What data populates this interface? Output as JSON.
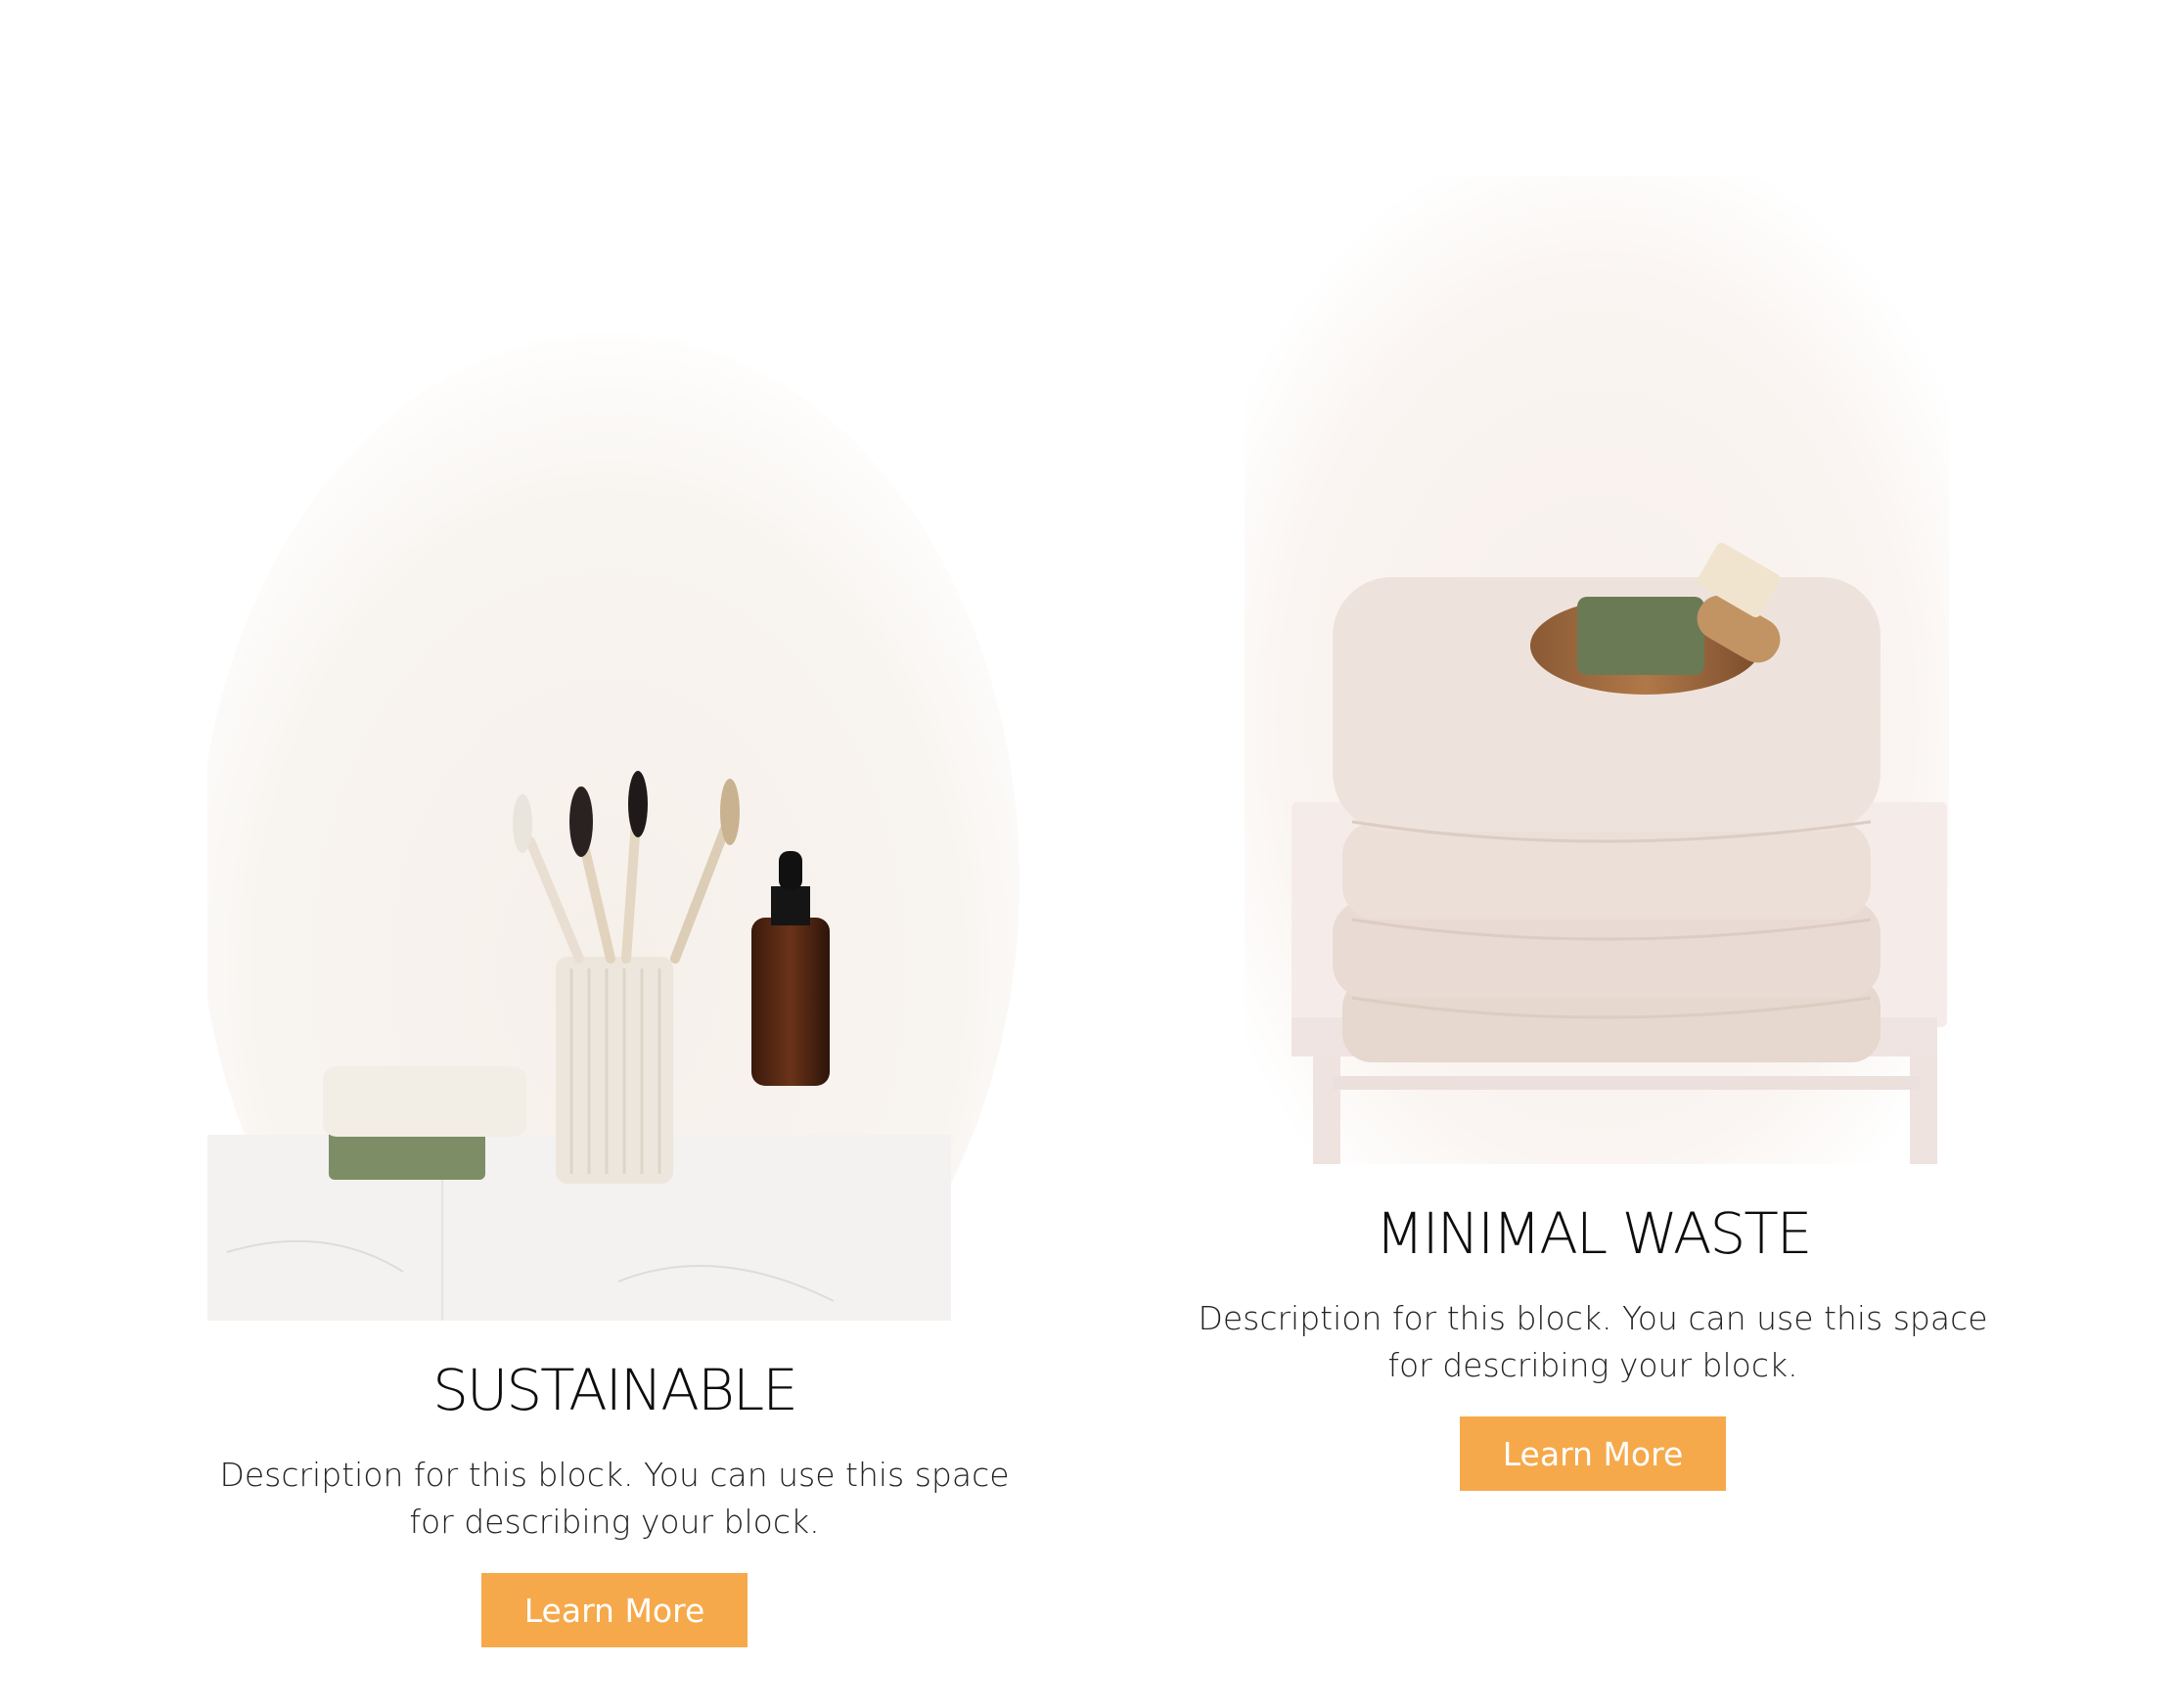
{
  "cards": [
    {
      "title": "SUSTAINABLE",
      "description": "Description for this block. You can use this space for describing your block.",
      "button_label": "Learn More",
      "image": "bathroom-essentials-photo"
    },
    {
      "title": "MINIMAL WASTE",
      "description": "Description for this block. You can use this space for describing your block.",
      "button_label": "Learn More",
      "image": "folded-towels-soap-photo"
    }
  ],
  "colors": {
    "button_bg": "#f6a94a",
    "button_text": "#ffffff",
    "title": "#0d0d0d",
    "background": "#ffffff"
  }
}
